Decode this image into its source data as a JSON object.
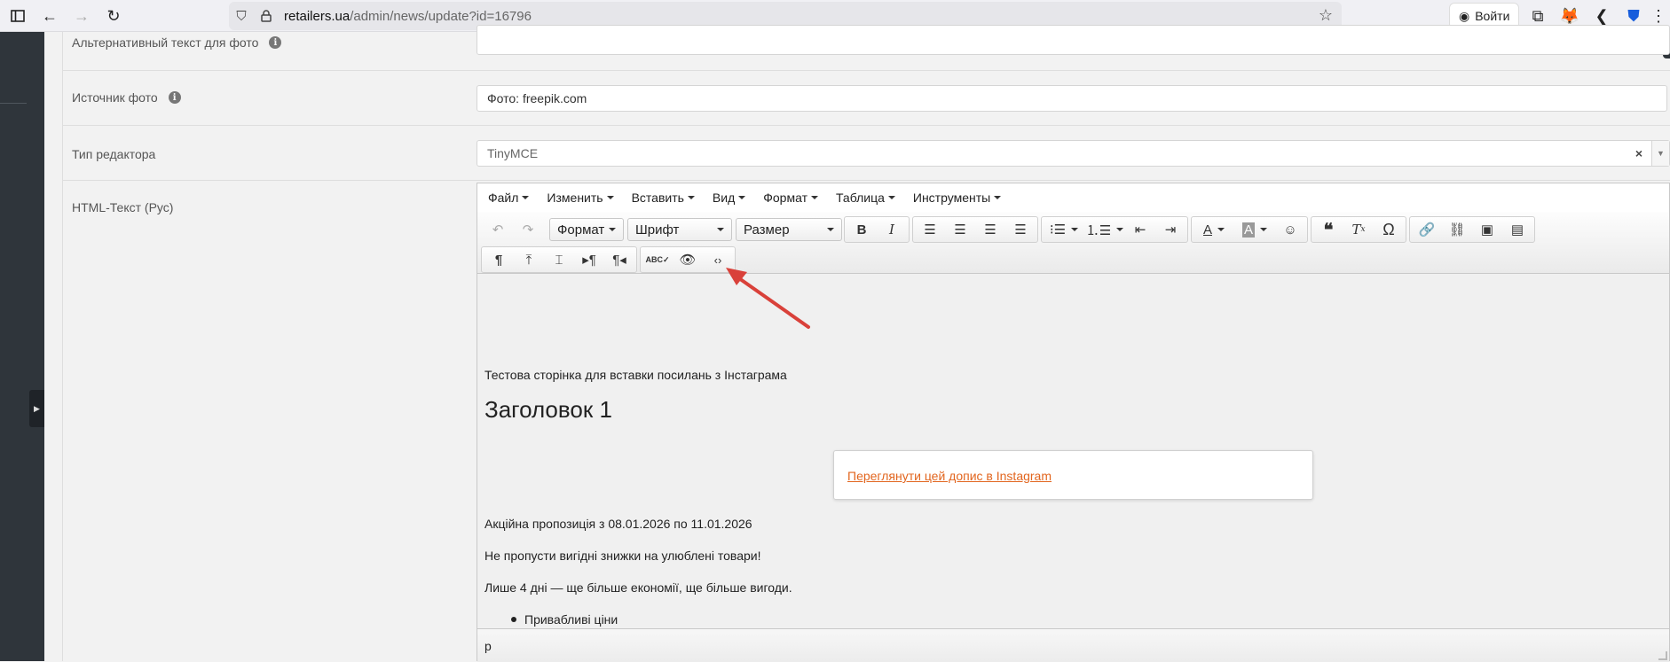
{
  "browser": {
    "url_host": "retailers.ua",
    "url_path": "/admin/news/update?id=16796",
    "login_label": "Войти"
  },
  "form": {
    "alt_text": {
      "label": "Альтернативный текст для фото",
      "value": ""
    },
    "photo_source": {
      "label": "Источник фото",
      "value": "Фото: freepik.com"
    },
    "editor_type": {
      "label": "Тип редактора",
      "value": "TinyMCE"
    },
    "html_text": {
      "label": "HTML-Текст (Рус)"
    }
  },
  "editor": {
    "menu": [
      "Файл",
      "Изменить",
      "Вставить",
      "Вид",
      "Формат",
      "Таблица",
      "Инструменты"
    ],
    "selects": {
      "format": "Формат",
      "font": "Шрифт",
      "size": "Размер"
    },
    "content": {
      "intro": "Тестова сторінка для вставки посилань з Інстаграма",
      "heading": "Заголовок 1",
      "instagram_link": "Переглянути цей допис в Instagram",
      "promo": "Акційна пропозиція з 08.01.2026 по 11.01.2026",
      "line2": "Не пропусти вигідні знижки на улюблені товари!",
      "line3": "Лише 4 дні — ще більше економії, ще більше вигоди.",
      "bullet1": "Привабливі ціни"
    },
    "status_path": "p"
  },
  "colors": {
    "sidebar": "#2f353b",
    "link": "#e2651e",
    "arrow": "#d9413a"
  }
}
